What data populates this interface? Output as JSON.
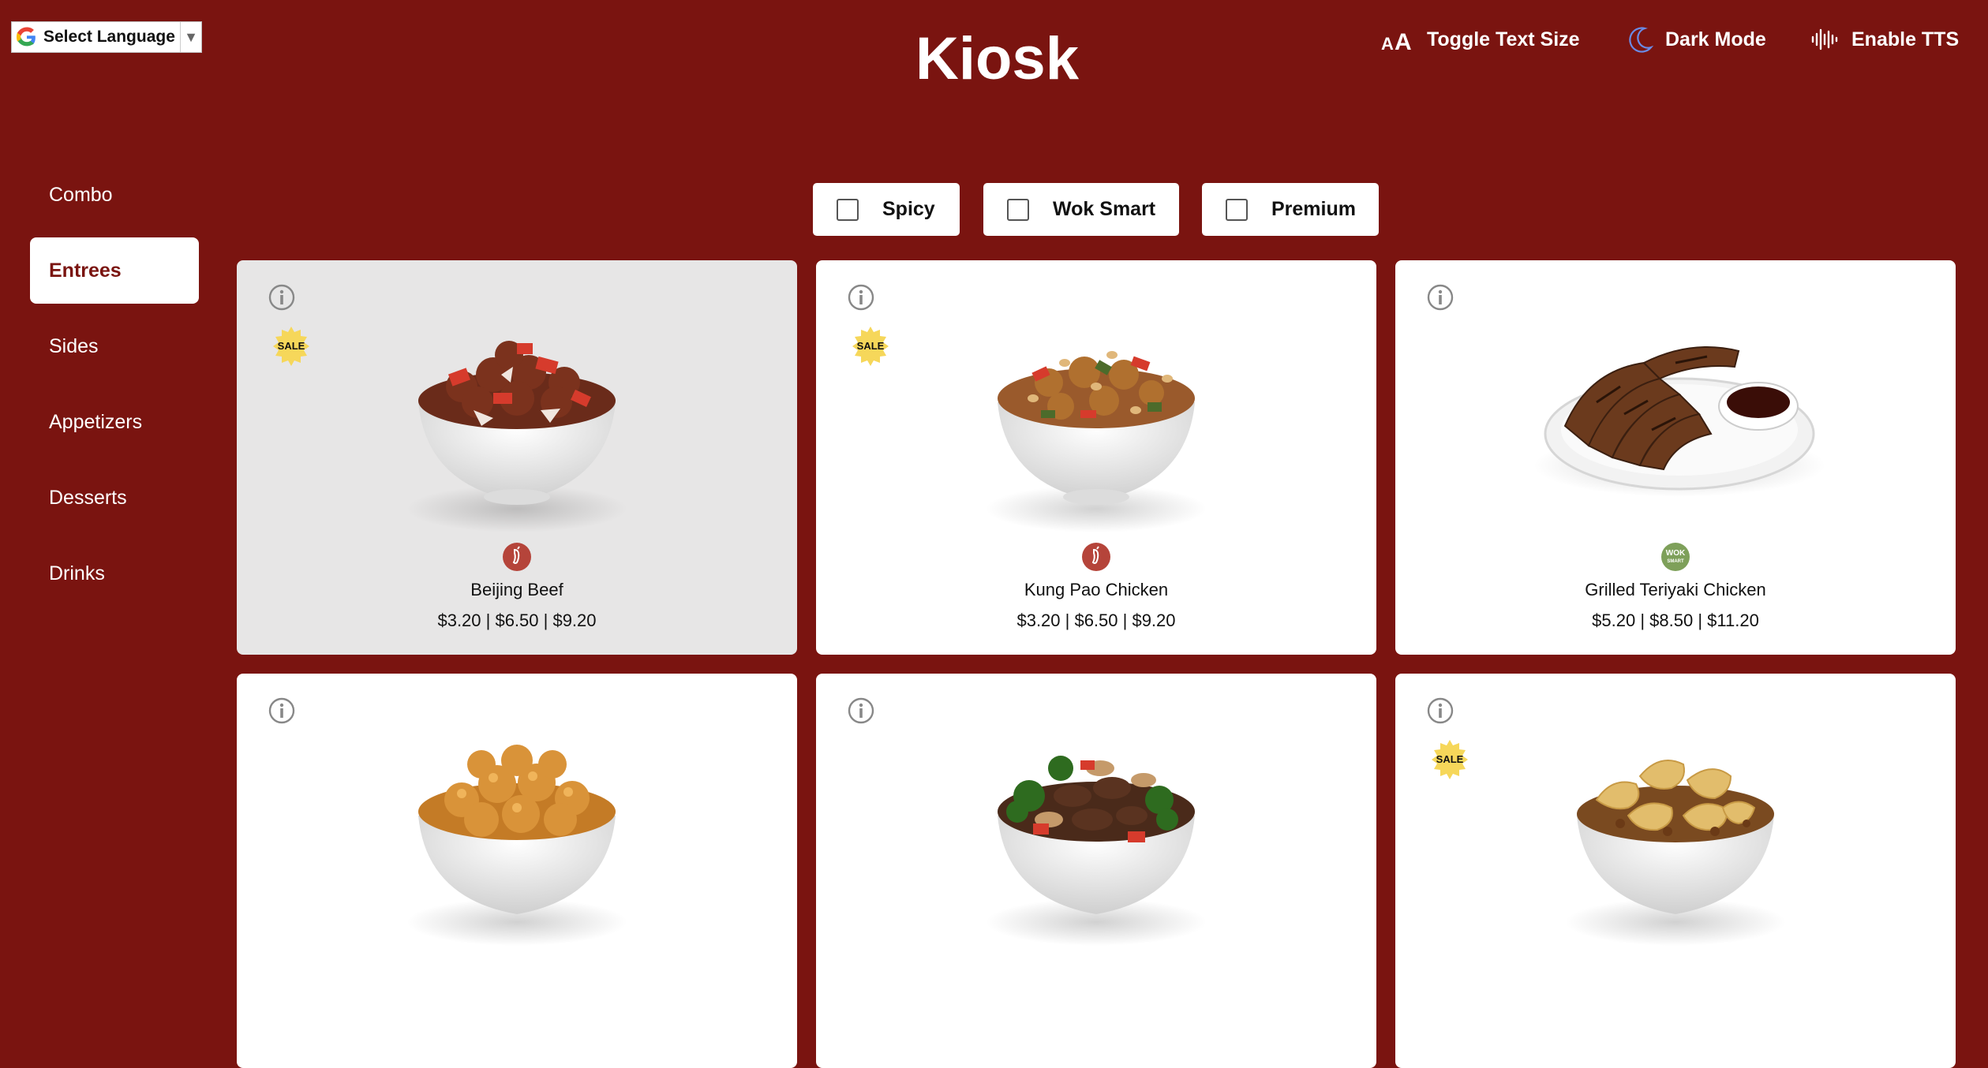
{
  "header": {
    "language_label": "Select Language",
    "language_icon": "google-g-icon",
    "title": "Kiosk",
    "buttons": [
      {
        "label": "Toggle Text Size",
        "icon": "text-size-icon"
      },
      {
        "label": "Dark Mode",
        "icon": "moon-icon"
      },
      {
        "label": "Enable TTS",
        "icon": "waveform-icon"
      }
    ]
  },
  "sidebar": {
    "items": [
      {
        "label": "Combo"
      },
      {
        "label": "Entrees"
      },
      {
        "label": "Sides"
      },
      {
        "label": "Appetizers"
      },
      {
        "label": "Desserts"
      },
      {
        "label": "Drinks"
      }
    ],
    "active": "Entrees"
  },
  "filters": [
    {
      "label": "Spicy",
      "checked": false
    },
    {
      "label": "Wok Smart",
      "checked": false
    },
    {
      "label": "Premium",
      "checked": false
    }
  ],
  "menu": {
    "items": [
      {
        "name": "Beijing Beef",
        "price": "$3.20 | $6.50 | $9.20",
        "badge_sale": "SALE",
        "tag": "spicy-icon",
        "image": "beijing-beef-bowl"
      },
      {
        "name": "Kung Pao Chicken",
        "price": "$3.20 | $6.50 | $9.20",
        "badge_sale": "SALE",
        "tag": "spicy-icon",
        "image": "kung-pao-chicken-bowl"
      },
      {
        "name": "Grilled Teriyaki Chicken",
        "price": "$5.20 | $8.50 | $11.20",
        "badge_sale": null,
        "tag": "wok-smart-icon",
        "tag_text": "WOK SMART",
        "image": "grilled-teriyaki-chicken-plate"
      },
      {
        "name": "",
        "price": "",
        "badge_sale": null,
        "image": "orange-chicken-bowl"
      },
      {
        "name": "",
        "price": "",
        "badge_sale": null,
        "image": "broccoli-beef-bowl"
      },
      {
        "name": "",
        "price": "",
        "badge_sale": "SALE",
        "image": "honey-walnut-shrimp-bowl"
      }
    ]
  },
  "colors": {
    "background": "#7a1410",
    "card": "#ffffff",
    "card_hover": "#e7e6e6",
    "sale_badge": "#f6d75a",
    "spicy_tag": "#b5443a",
    "wok_smart_tag": "#7ea05a"
  }
}
